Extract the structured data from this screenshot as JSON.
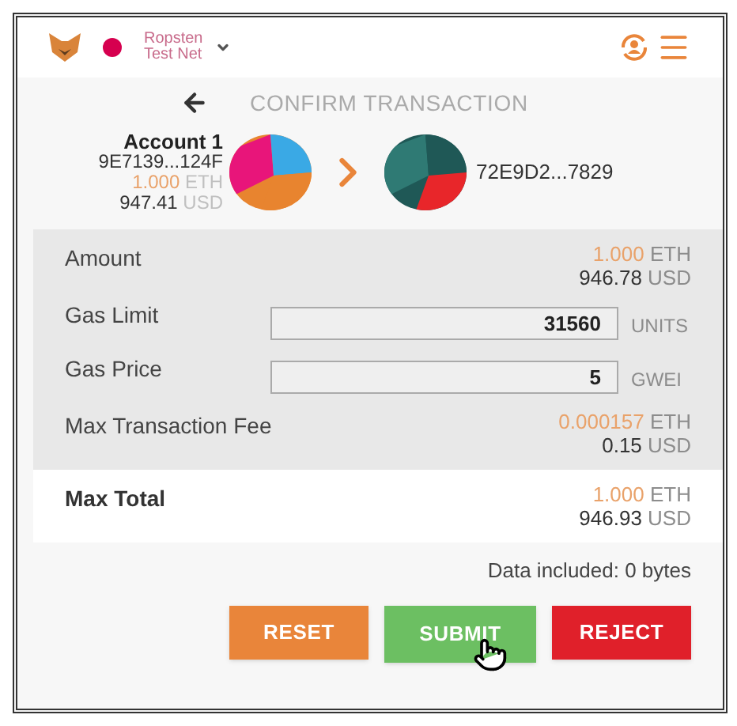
{
  "header": {
    "network": {
      "name": "Ropsten\nTest Net",
      "color": "#d6004f"
    }
  },
  "title": "CONFIRM TRANSACTION",
  "sender": {
    "name": "Account 1",
    "address": "9E7139...124F",
    "eth_value": "1.000",
    "eth_unit": "ETH",
    "usd_value": "947.41",
    "usd_unit": "USD"
  },
  "recipient": {
    "address": "72E9D2...7829"
  },
  "details": [
    {
      "kind": "amount",
      "label": "Amount",
      "eth_value": "1.000",
      "eth_unit": "ETH",
      "usd_value": "946.78",
      "usd_unit": "USD"
    },
    {
      "kind": "input",
      "label": "Gas Limit",
      "value": "31560",
      "unit": "UNITS"
    },
    {
      "kind": "input",
      "label": "Gas Price",
      "value": "5",
      "unit": "GWEI"
    },
    {
      "kind": "amount",
      "label": "Max Transaction Fee",
      "eth_value": "0.000157",
      "eth_unit": "ETH",
      "usd_value": "0.15",
      "usd_unit": "USD"
    }
  ],
  "total": {
    "label": "Max Total",
    "eth_value": "1.000",
    "eth_unit": "ETH",
    "usd_value": "946.93",
    "usd_unit": "USD"
  },
  "data_note": "Data included: 0 bytes",
  "buttons": [
    {
      "kind": "reset",
      "label": "RESET",
      "hovered": false
    },
    {
      "kind": "submit",
      "label": "SUBMIT",
      "hovered": true
    },
    {
      "kind": "reject",
      "label": "REJECT",
      "hovered": false
    }
  ]
}
